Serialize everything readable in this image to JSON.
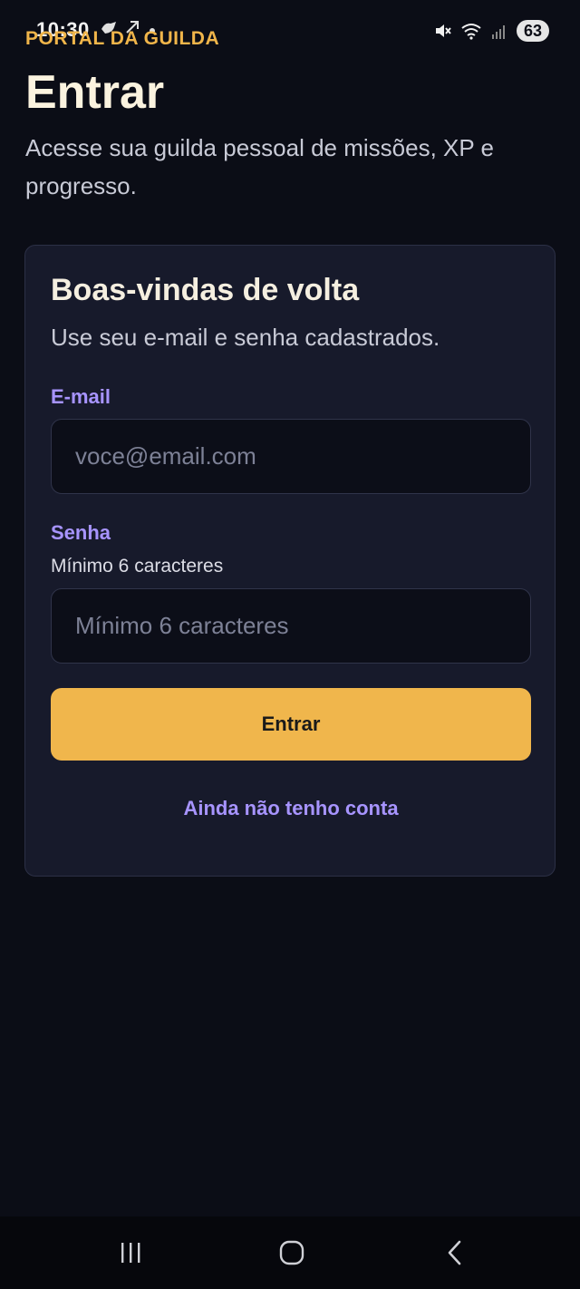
{
  "status_bar": {
    "time": "10:30",
    "battery": "63",
    "icons": [
      "notification-icon",
      "mute-icon",
      "wifi-icon",
      "signal-icon"
    ]
  },
  "header": {
    "eyebrow": "PORTAL DA GUILDA",
    "title": "Entrar",
    "subtitle": "Acesse sua guilda pessoal de missões, XP e progresso."
  },
  "card": {
    "title": "Boas-vindas de volta",
    "subtitle": "Use seu e-mail e senha cadastrados.",
    "email": {
      "label": "E-mail",
      "placeholder": "voce@email.com",
      "value": ""
    },
    "password": {
      "label": "Senha",
      "hint": "Mínimo 6 caracteres",
      "placeholder": "Mínimo 6 caracteres",
      "value": ""
    },
    "submit_label": "Entrar",
    "signup_link": "Ainda não tenho conta"
  },
  "nav_bar": {
    "icons": [
      "recent-apps-icon",
      "home-icon",
      "back-icon"
    ]
  },
  "colors": {
    "background": "#0b0d16",
    "card": "#171a2b",
    "accent": "#f0b64c",
    "link": "#a794ff"
  }
}
